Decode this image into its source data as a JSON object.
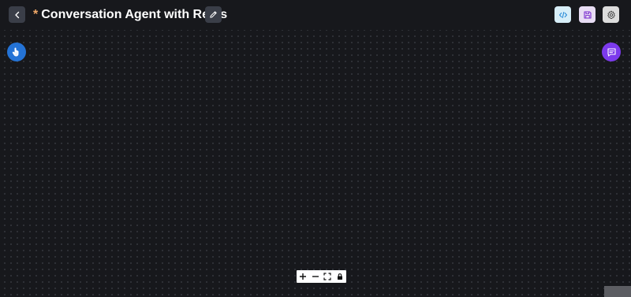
{
  "header": {
    "unsaved_marker": "*",
    "title": "Conversation Agent with Redis"
  },
  "icons": {
    "back": "chevron-left-icon",
    "edit": "pencil-icon",
    "api": "code-icon",
    "save": "save-icon",
    "settings": "gear-icon",
    "drag": "hand-pointer-icon",
    "chat": "message-icon",
    "zoom_in": "plus-icon",
    "zoom_out": "minus-icon",
    "fit_view": "fullscreen-icon",
    "lock": "lock-icon"
  },
  "colors": {
    "canvas_bg": "#17181c",
    "title_asterisk": "#f0a868",
    "left_fab": "#2473d6",
    "right_fab": "#7c3aed"
  }
}
